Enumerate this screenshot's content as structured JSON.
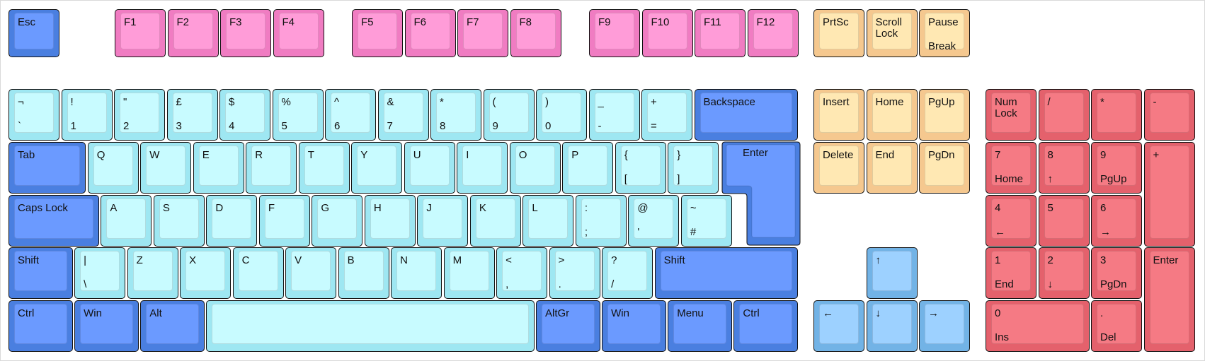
{
  "colors": {
    "esc": {
      "base": "#4a7fe0",
      "face": "#6b9aff"
    },
    "func": {
      "base": "#f07cc2",
      "face": "#ff9cd8"
    },
    "alpha": {
      "base": "#9ee7f2",
      "face": "#c8fbff"
    },
    "mod": {
      "base": "#4a7fe0",
      "face": "#6b9aff"
    },
    "nav": {
      "base": "#f5c88f",
      "face": "#ffe8b3"
    },
    "arrow": {
      "base": "#72b3e6",
      "face": "#9dd1ff"
    },
    "num": {
      "base": "#e4616c",
      "face": "#f57a84"
    }
  },
  "rows": {
    "function": [
      {
        "id": "esc",
        "top": "Esc",
        "color": "esc"
      },
      {
        "id": "f1",
        "top": "F1",
        "color": "func"
      },
      {
        "id": "f2",
        "top": "F2",
        "color": "func"
      },
      {
        "id": "f3",
        "top": "F3",
        "color": "func"
      },
      {
        "id": "f4",
        "top": "F4",
        "color": "func"
      },
      {
        "id": "f5",
        "top": "F5",
        "color": "func"
      },
      {
        "id": "f6",
        "top": "F6",
        "color": "func"
      },
      {
        "id": "f7",
        "top": "F7",
        "color": "func"
      },
      {
        "id": "f8",
        "top": "F8",
        "color": "func"
      },
      {
        "id": "f9",
        "top": "F9",
        "color": "func"
      },
      {
        "id": "f10",
        "top": "F10",
        "color": "func"
      },
      {
        "id": "f11",
        "top": "F11",
        "color": "func"
      },
      {
        "id": "f12",
        "top": "F12",
        "color": "func"
      },
      {
        "id": "prtsc",
        "top": "PrtSc",
        "color": "nav"
      },
      {
        "id": "scroll-lock",
        "top": "Scroll\nLock",
        "color": "nav",
        "wrap": true
      },
      {
        "id": "pause",
        "top": "Pause",
        "bot": "Break",
        "color": "nav"
      }
    ],
    "number": [
      {
        "id": "backtick",
        "top": "¬",
        "bot": "`",
        "color": "alpha"
      },
      {
        "id": "1",
        "top": "!",
        "bot": "1",
        "color": "alpha"
      },
      {
        "id": "2",
        "top": "\"",
        "bot": "2",
        "color": "alpha"
      },
      {
        "id": "3",
        "top": "£",
        "bot": "3",
        "color": "alpha"
      },
      {
        "id": "4",
        "top": "$",
        "bot": "4",
        "color": "alpha"
      },
      {
        "id": "5",
        "top": "%",
        "bot": "5",
        "color": "alpha"
      },
      {
        "id": "6",
        "top": "^",
        "bot": "6",
        "color": "alpha"
      },
      {
        "id": "7",
        "top": "&",
        "bot": "7",
        "color": "alpha"
      },
      {
        "id": "8",
        "top": "*",
        "bot": "8",
        "color": "alpha"
      },
      {
        "id": "9",
        "top": "(",
        "bot": "9",
        "color": "alpha"
      },
      {
        "id": "0",
        "top": ")",
        "bot": "0",
        "color": "alpha"
      },
      {
        "id": "minus",
        "top": "_",
        "bot": "-",
        "color": "alpha"
      },
      {
        "id": "equals",
        "top": "+",
        "bot": "=",
        "color": "alpha"
      },
      {
        "id": "backspace",
        "top": "Backspace",
        "color": "mod"
      },
      {
        "id": "insert",
        "top": "Insert",
        "color": "nav"
      },
      {
        "id": "home",
        "top": "Home",
        "color": "nav"
      },
      {
        "id": "pgup",
        "top": "PgUp",
        "color": "nav"
      },
      {
        "id": "numlock",
        "top": "Num\nLock",
        "color": "num",
        "wrap": true
      },
      {
        "id": "num-slash",
        "top": "/",
        "color": "num"
      },
      {
        "id": "num-star",
        "top": "*",
        "color": "num"
      },
      {
        "id": "num-minus",
        "top": "-",
        "color": "num"
      }
    ],
    "qwerty": [
      {
        "id": "tab",
        "top": "Tab",
        "color": "mod"
      },
      {
        "id": "q",
        "top": "Q",
        "color": "alpha"
      },
      {
        "id": "w",
        "top": "W",
        "color": "alpha"
      },
      {
        "id": "e",
        "top": "E",
        "color": "alpha"
      },
      {
        "id": "r",
        "top": "R",
        "color": "alpha"
      },
      {
        "id": "t",
        "top": "T",
        "color": "alpha"
      },
      {
        "id": "y",
        "top": "Y",
        "color": "alpha"
      },
      {
        "id": "u",
        "top": "U",
        "color": "alpha"
      },
      {
        "id": "i",
        "top": "I",
        "color": "alpha"
      },
      {
        "id": "o",
        "top": "O",
        "color": "alpha"
      },
      {
        "id": "p",
        "top": "P",
        "color": "alpha"
      },
      {
        "id": "lbracket",
        "top": "{",
        "bot": "[",
        "color": "alpha"
      },
      {
        "id": "rbracket",
        "top": "}",
        "bot": "]",
        "color": "alpha"
      },
      {
        "id": "delete",
        "top": "Delete",
        "color": "nav"
      },
      {
        "id": "end",
        "top": "End",
        "color": "nav"
      },
      {
        "id": "pgdn",
        "top": "PgDn",
        "color": "nav"
      },
      {
        "id": "num7",
        "top": "7",
        "bot": "Home",
        "color": "num"
      },
      {
        "id": "num8",
        "top": "8",
        "bot": "↑",
        "color": "num"
      },
      {
        "id": "num9",
        "top": "9",
        "bot": "PgUp",
        "color": "num"
      },
      {
        "id": "num-plus",
        "top": "+",
        "color": "num"
      }
    ],
    "home": [
      {
        "id": "capslock",
        "top": "Caps Lock",
        "color": "mod"
      },
      {
        "id": "a",
        "top": "A",
        "color": "alpha"
      },
      {
        "id": "s",
        "top": "S",
        "color": "alpha"
      },
      {
        "id": "d",
        "top": "D",
        "color": "alpha"
      },
      {
        "id": "f",
        "top": "F",
        "color": "alpha"
      },
      {
        "id": "g",
        "top": "G",
        "color": "alpha"
      },
      {
        "id": "h",
        "top": "H",
        "color": "alpha"
      },
      {
        "id": "j",
        "top": "J",
        "color": "alpha"
      },
      {
        "id": "k",
        "top": "K",
        "color": "alpha"
      },
      {
        "id": "l",
        "top": "L",
        "color": "alpha"
      },
      {
        "id": "semicolon",
        "top": ":",
        "bot": ";",
        "color": "alpha"
      },
      {
        "id": "quote",
        "top": "@",
        "bot": "'",
        "color": "alpha"
      },
      {
        "id": "hash",
        "top": "~",
        "bot": "#",
        "color": "alpha"
      },
      {
        "id": "num4",
        "top": "4",
        "bot": "←",
        "color": "num"
      },
      {
        "id": "num5",
        "top": "5",
        "color": "num"
      },
      {
        "id": "num6",
        "top": "6",
        "bot": "→",
        "color": "num"
      }
    ],
    "shift": [
      {
        "id": "lshift",
        "top": "Shift",
        "color": "mod"
      },
      {
        "id": "backslash",
        "top": "|",
        "bot": "\\",
        "color": "alpha"
      },
      {
        "id": "z",
        "top": "Z",
        "color": "alpha"
      },
      {
        "id": "x",
        "top": "X",
        "color": "alpha"
      },
      {
        "id": "c",
        "top": "C",
        "color": "alpha"
      },
      {
        "id": "v",
        "top": "V",
        "color": "alpha"
      },
      {
        "id": "b",
        "top": "B",
        "color": "alpha"
      },
      {
        "id": "n",
        "top": "N",
        "color": "alpha"
      },
      {
        "id": "m",
        "top": "M",
        "color": "alpha"
      },
      {
        "id": "comma",
        "top": "<",
        "bot": ",",
        "color": "alpha"
      },
      {
        "id": "period",
        "top": ">",
        "bot": ".",
        "color": "alpha"
      },
      {
        "id": "slash",
        "top": "?",
        "bot": "/",
        "color": "alpha"
      },
      {
        "id": "rshift",
        "top": "Shift",
        "color": "mod"
      },
      {
        "id": "arrow-up",
        "top": "↑",
        "color": "arrow"
      },
      {
        "id": "num1",
        "top": "1",
        "bot": "End",
        "color": "num"
      },
      {
        "id": "num2",
        "top": "2",
        "bot": "↓",
        "color": "num"
      },
      {
        "id": "num3",
        "top": "3",
        "bot": "PgDn",
        "color": "num"
      },
      {
        "id": "num-enter",
        "top": "Enter",
        "color": "num"
      }
    ],
    "bottom": [
      {
        "id": "lctrl",
        "top": "Ctrl",
        "color": "mod"
      },
      {
        "id": "lwin",
        "top": "Win",
        "color": "mod"
      },
      {
        "id": "alt",
        "top": "Alt",
        "color": "mod"
      },
      {
        "id": "space",
        "top": "",
        "color": "alpha"
      },
      {
        "id": "altgr",
        "top": "AltGr",
        "color": "mod"
      },
      {
        "id": "rwin",
        "top": "Win",
        "color": "mod"
      },
      {
        "id": "menu",
        "top": "Menu",
        "color": "mod"
      },
      {
        "id": "rctrl",
        "top": "Ctrl",
        "color": "mod"
      },
      {
        "id": "arrow-left",
        "top": "←",
        "color": "arrow"
      },
      {
        "id": "arrow-down",
        "top": "↓",
        "color": "arrow"
      },
      {
        "id": "arrow-right",
        "top": "→",
        "color": "arrow"
      },
      {
        "id": "num0",
        "top": "0",
        "bot": "Ins",
        "color": "num"
      },
      {
        "id": "num-dot",
        "top": ".",
        "bot": "Del",
        "color": "num"
      }
    ]
  },
  "enter": {
    "label": "Enter",
    "color": "mod"
  }
}
